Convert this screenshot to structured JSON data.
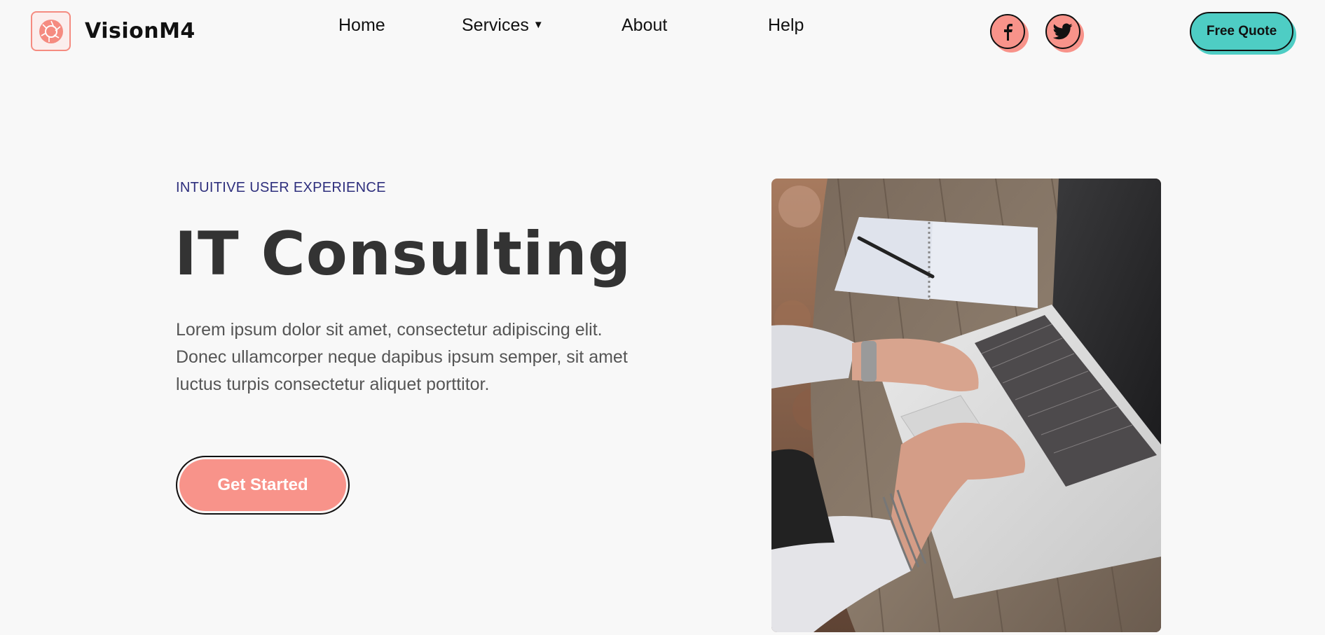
{
  "brand": {
    "name": "VisionM4",
    "logo_icon": "camera-aperture-icon",
    "accent_color": "#f8938a"
  },
  "nav": {
    "home": "Home",
    "services": "Services",
    "about": "About",
    "help": "Help"
  },
  "social": {
    "facebook_icon": "facebook-icon",
    "twitter_icon": "twitter-icon"
  },
  "header_cta": {
    "label": "Free Quote",
    "color": "#4ecdc4"
  },
  "hero": {
    "eyebrow": "INTUITIVE USER EXPERIENCE",
    "title": "IT Consulting",
    "body_lines": [
      "Lorem ipsum dolor sit amet, consectetur adipiscing elit.",
      "Donec ullamcorper neque dapibus ipsum semper, sit amet",
      "luctus turpis consectetur aliquet porttitor."
    ],
    "cta_label": "Get Started",
    "image_subject": "hands typing on laptop on wooden table"
  }
}
